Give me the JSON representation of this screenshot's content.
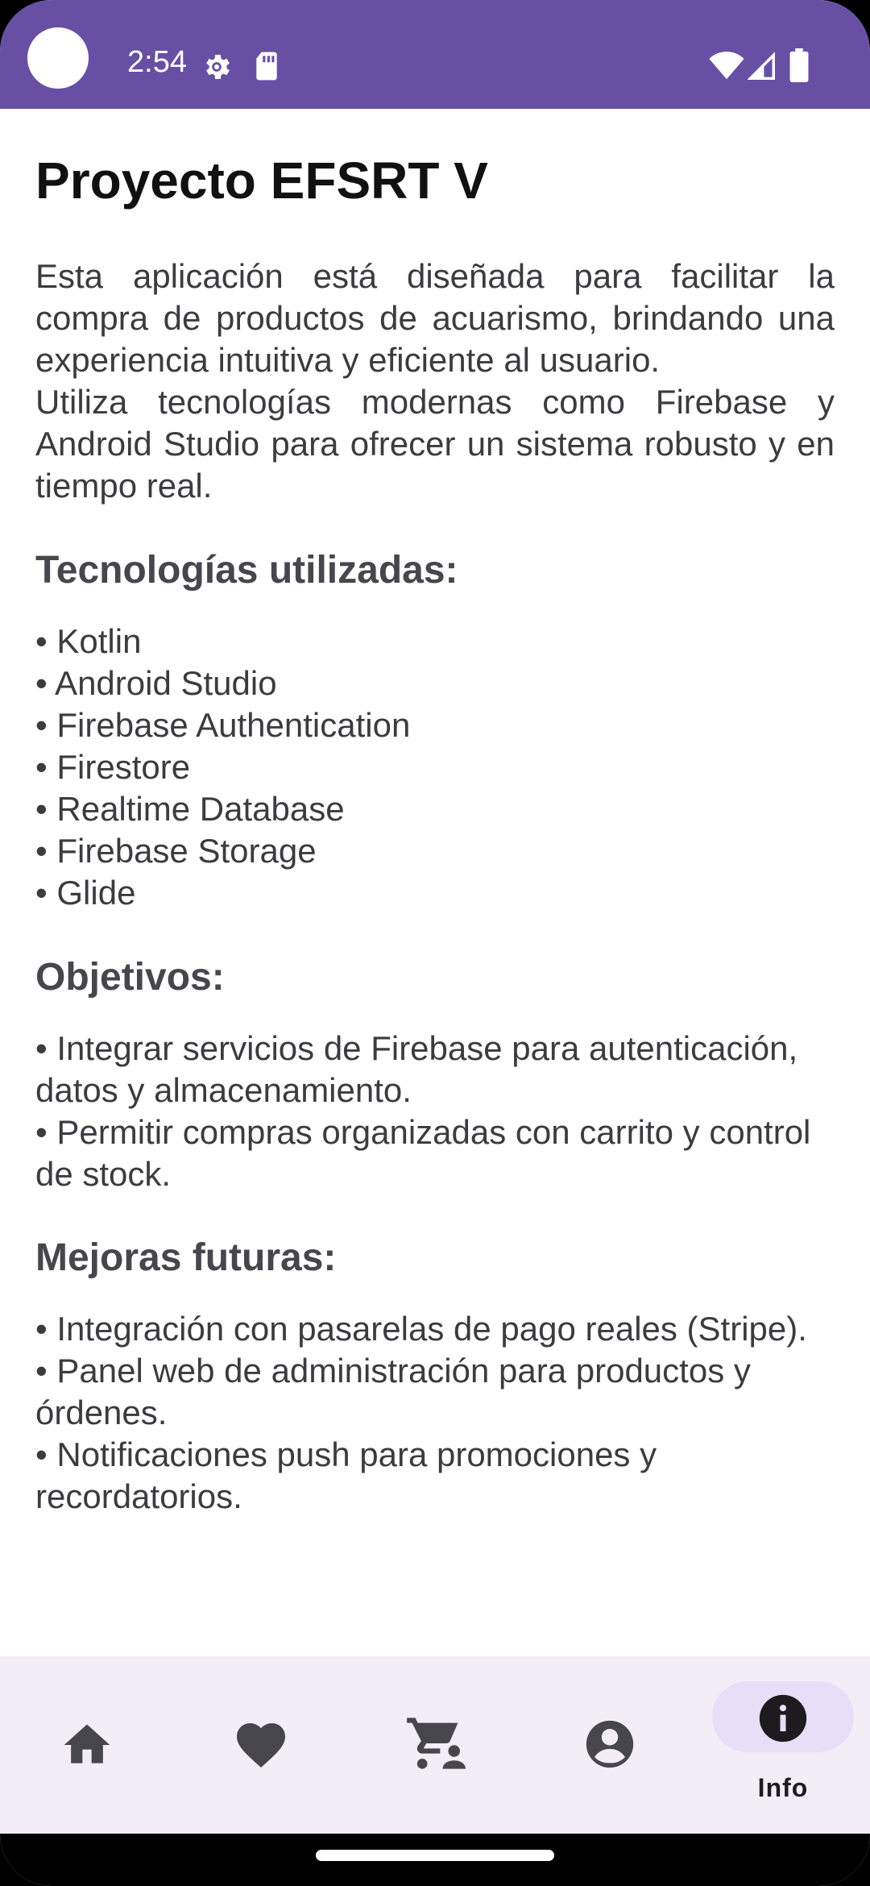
{
  "status_bar": {
    "time": "2:54",
    "color": "#6750A4",
    "left_icons": [
      "gear-icon",
      "sd-card-icon"
    ],
    "right_icons": [
      "wifi-icon",
      "signal-icon",
      "battery-icon"
    ]
  },
  "page": {
    "title": "Proyecto EFSRT V",
    "intro_paragraphs": [
      "Esta aplicación está diseñada para facilitar la compra de productos de acuarismo, brindando una experiencia intuitiva y eficiente al usuario.",
      "Utiliza tecnologías modernas como Firebase y Android Studio para ofrecer un sistema robusto y en tiempo real."
    ],
    "technologies": {
      "heading": "Tecnologías utilizadas:",
      "items": [
        "• Kotlin",
        "• Android Studio",
        "• Firebase Authentication",
        "• Firestore",
        "• Realtime Database",
        "• Firebase Storage",
        "• Glide"
      ]
    },
    "objectives": {
      "heading": "Objetivos:",
      "items": [
        "• Integrar servicios de Firebase para autenticación, datos y almacenamiento.",
        "• Permitir compras organizadas con carrito y control de stock."
      ]
    },
    "future": {
      "heading": "Mejoras futuras:",
      "items": [
        "• Integración con pasarelas de pago reales (Stripe).",
        "• Panel web de administración para productos y órdenes.",
        "• Notificaciones push para promociones y recordatorios."
      ]
    }
  },
  "bottom_nav": {
    "background": "#F3EDF7",
    "active_indicator": "#E8DEF8",
    "items": [
      {
        "icon": "home-icon",
        "label": "",
        "active": false
      },
      {
        "icon": "heart-icon",
        "label": "",
        "active": false
      },
      {
        "icon": "cart-icon",
        "label": "",
        "active": false
      },
      {
        "icon": "account-icon",
        "label": "",
        "active": false
      },
      {
        "icon": "info-icon",
        "label": "Info",
        "active": true
      }
    ]
  }
}
